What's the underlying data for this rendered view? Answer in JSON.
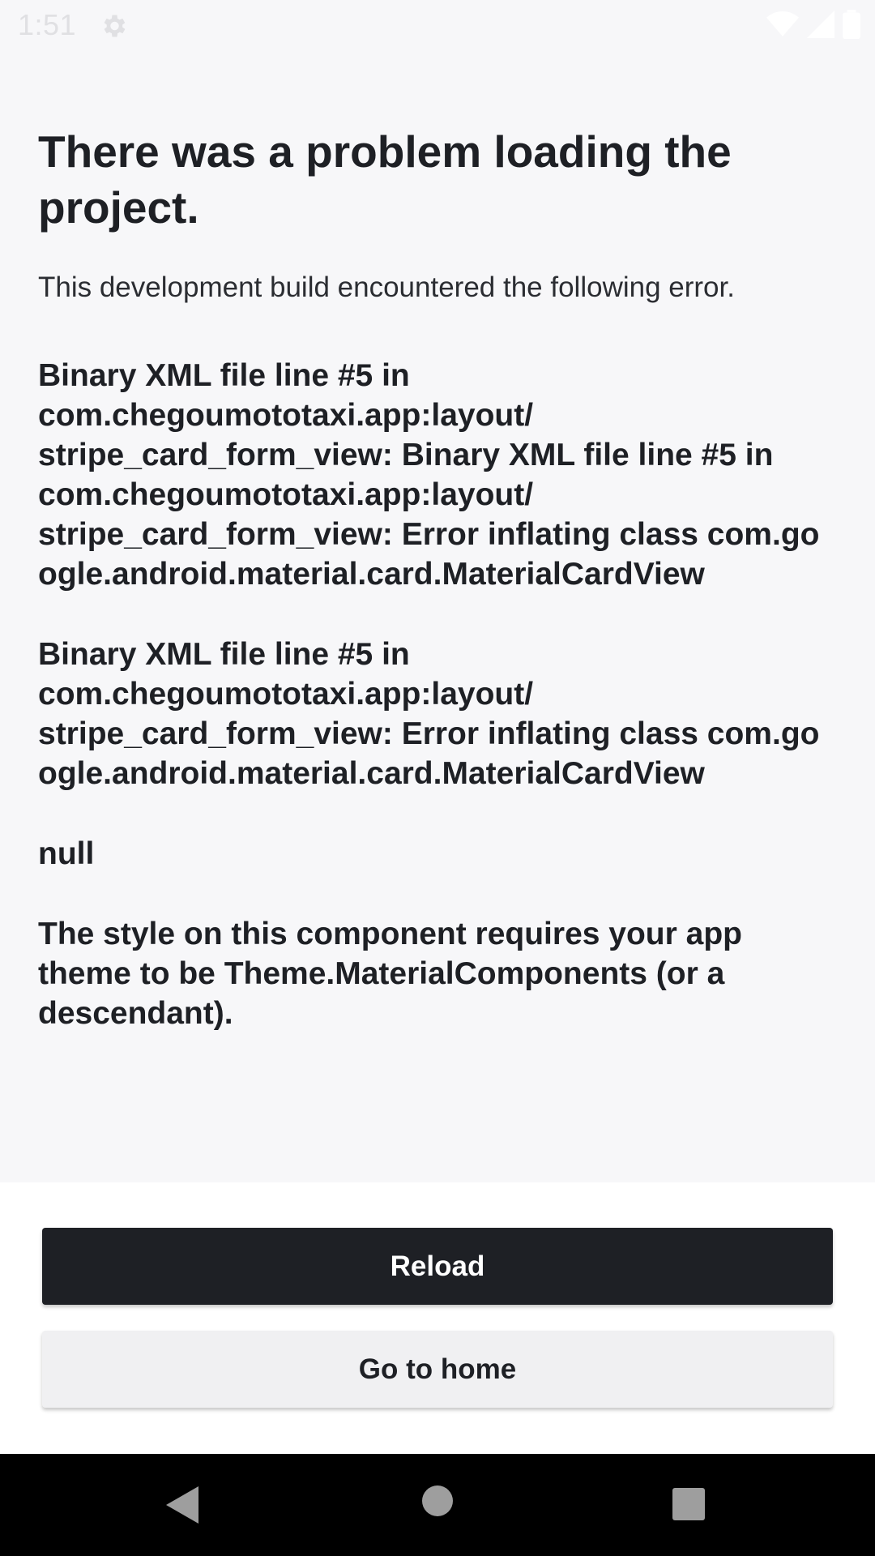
{
  "status_bar": {
    "time": "1:51",
    "icons": [
      "settings-icon",
      "wifi-icon",
      "signal-icon",
      "battery-icon"
    ]
  },
  "content": {
    "title": "There was a problem loading the project.",
    "subtitle": "This development build encountered the following error.",
    "errors": [
      "Binary XML file line #5 in com.chegoumototaxi.app:layout/ stripe_card_form_view: Binary XML file line #5 in com.chegoumototaxi.app:layout/ stripe_card_form_view: Error inflating class com.go ogle.android.material.card.MaterialCardView",
      "Binary XML file line #5 in com.chegoumototaxi.app:layout/ stripe_card_form_view: Error inflating class com.go ogle.android.material.card.MaterialCardView",
      "null",
      "The style on this component requires your app theme to be Theme.MaterialComponents (or a descendant)."
    ]
  },
  "actions": {
    "reload_label": "Reload",
    "home_label": "Go to home"
  },
  "nav_bar": {
    "icons": [
      "back-icon",
      "home-icon",
      "recents-icon"
    ]
  },
  "colors": {
    "background": "#f7f7f9",
    "text": "#1e2025",
    "primary_button": "#1e2025",
    "secondary_button": "#f0f0f2",
    "nav_bar": "#000000"
  }
}
